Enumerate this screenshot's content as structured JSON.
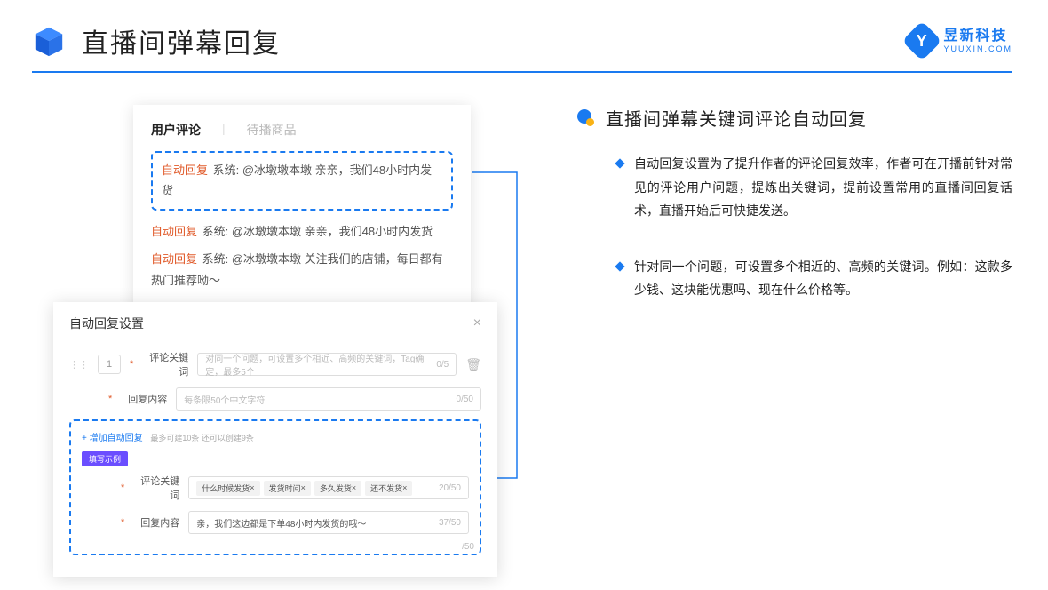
{
  "header": {
    "title": "直播间弹幕回复",
    "brand_main": "昱新科技",
    "brand_sub": "YUUXIN.COM"
  },
  "comments": {
    "tab_active": "用户评论",
    "tab_inactive": "待播商品",
    "auto_label": "自动回复",
    "line1_rest": " 系统: @冰墩墩本墩 亲亲，我们48小时内发货",
    "line2_rest": " 系统: @冰墩墩本墩 亲亲，我们48小时内发货",
    "line3_rest": " 系统: @冰墩墩本墩 关注我们的店铺，每日都有热门推荐呦～"
  },
  "settings": {
    "panel_title": "自动回复设置",
    "order": "1",
    "label_keyword": "评论关键词",
    "label_content": "回复内容",
    "ph_keyword": "对同一个问题，可设置多个相近、高频的关键词，Tag确定，最多5个",
    "ph_content": "每条限50个中文字符",
    "cnt0_5": "0/5",
    "cnt0_50": "0/50",
    "hint_add": "+ 增加自动回复",
    "hint_limit": "最多可建10条 还可以创建9条",
    "example_badge": "填写示例",
    "ex_chip1": "什么时候发货",
    "ex_chip2": "发货时间",
    "ex_chip3": "多久发货",
    "ex_chip4": "还不发货",
    "ex_cnt_kw": "20/50",
    "ex_content": "亲，我们这边都是下单48小时内发货的哦～",
    "ex_cnt_ct": "37/50",
    "outside_counter": "/50"
  },
  "right": {
    "section_title": "直播间弹幕关键词评论自动回复",
    "point1": "自动回复设置为了提升作者的评论回复效率，作者可在开播前针对常见的评论用户问题，提炼出关键词，提前设置常用的直播间回复话术，直播开始后可快捷发送。",
    "point2": "针对同一个问题，可设置多个相近的、高频的关键词。例如：这款多少钱、这块能优惠吗、现在什么价格等。"
  }
}
